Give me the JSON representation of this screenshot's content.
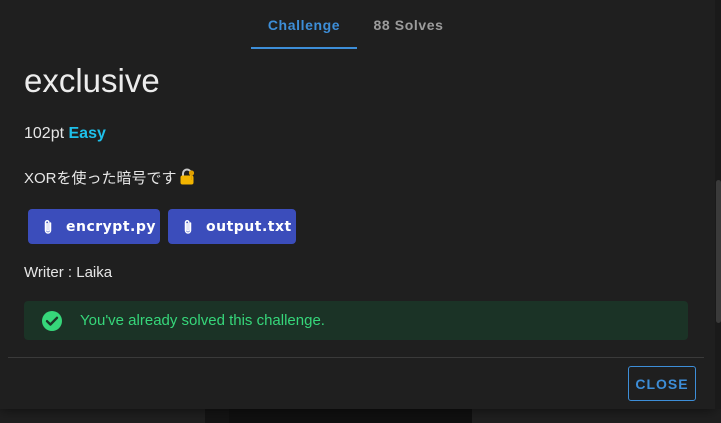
{
  "tabs": [
    {
      "label": "Challenge",
      "active": true
    },
    {
      "label": "88 Solves",
      "active": false
    }
  ],
  "challenge": {
    "title": "exclusive",
    "points": "102pt",
    "difficulty": "Easy",
    "description": "XORを使った暗号です",
    "files": [
      {
        "name": "encrypt.py",
        "icon": "paperclip-icon"
      },
      {
        "name": "output.txt",
        "icon": "paperclip-icon"
      }
    ],
    "writer": "Writer : Laika"
  },
  "alert": {
    "icon": "check-circle-icon",
    "text": "You've already solved this challenge."
  },
  "footer": {
    "close_label": "CLOSE"
  },
  "colors": {
    "accent": "#3d8ed8",
    "difficulty": "#1ec0ea",
    "file_button": "#3b4dbb",
    "success_text": "#36d67a",
    "success_bg": "#1b3326"
  }
}
